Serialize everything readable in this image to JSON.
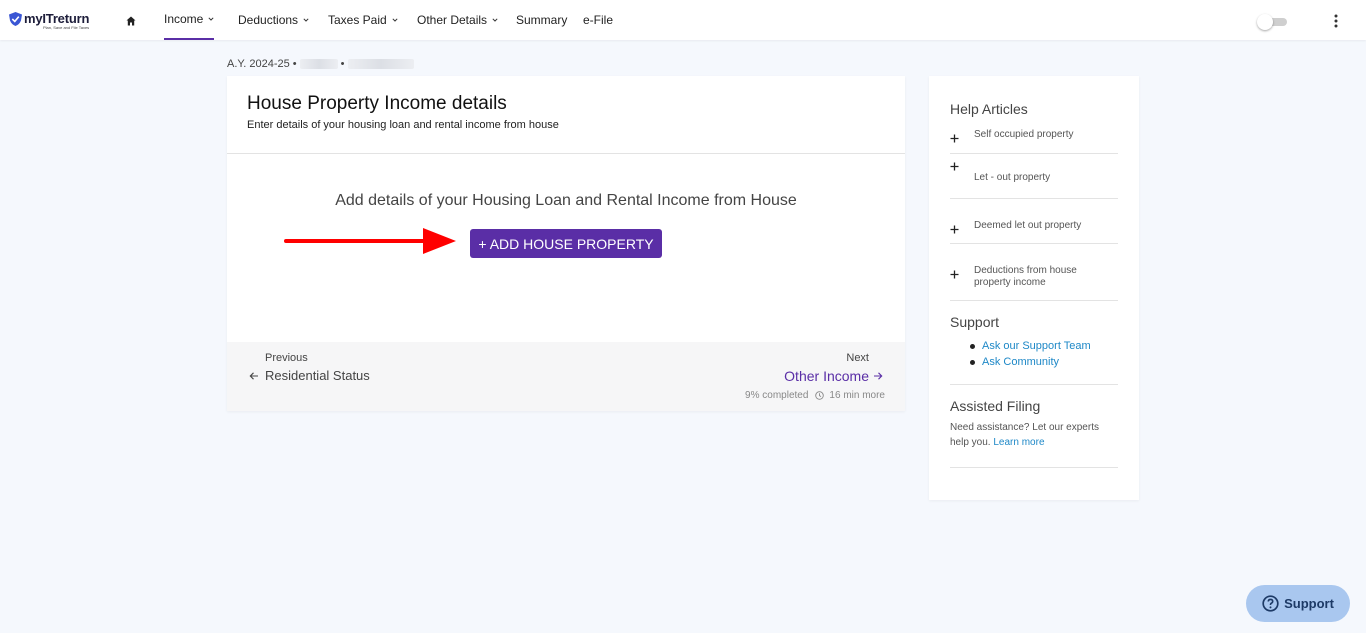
{
  "nav": {
    "logo_name": "myITreturn",
    "logo_tagline": "Plan, Save and File Taxes",
    "items": [
      {
        "label": "Income"
      },
      {
        "label": "Deductions"
      },
      {
        "label": "Taxes Paid"
      },
      {
        "label": "Other Details"
      },
      {
        "label": "Summary"
      },
      {
        "label": "e-File"
      }
    ],
    "active_item": "Income"
  },
  "breadcrumb": {
    "assessment_year": "A.Y. 2024-25",
    "separator": "•"
  },
  "main": {
    "title": "House Property Income details",
    "subtitle": "Enter details of your housing loan and rental income from house",
    "prompt": "Add details of your Housing Loan and Rental Income from House",
    "add_button_label": "+ ADD HOUSE PROPERTY",
    "footer": {
      "previous_label": "Previous",
      "previous_link": "Residential Status",
      "next_label": "Next",
      "next_link": "Other Income",
      "progress_text": "9% completed",
      "time_remaining": "16 min more"
    }
  },
  "sidebar": {
    "help_title": "Help Articles",
    "help_items": [
      {
        "label": "Self occupied property"
      },
      {
        "label": "Let - out property"
      },
      {
        "label": "Deemed let out property"
      },
      {
        "label": "Deductions from house property income"
      }
    ],
    "support_title": "Support",
    "support_links": [
      {
        "label": "Ask our Support Team"
      },
      {
        "label": "Ask Community"
      }
    ],
    "assisted_title": "Assisted Filing",
    "assisted_text": "Need assistance? Let our experts help you.",
    "assisted_link": "Learn more"
  },
  "support_widget": {
    "label": "Support"
  },
  "colors": {
    "accent": "#5a2ea6",
    "link": "#1e88c7",
    "annotation_arrow": "#ff0000",
    "support_widget_bg": "#a9c7ef"
  }
}
